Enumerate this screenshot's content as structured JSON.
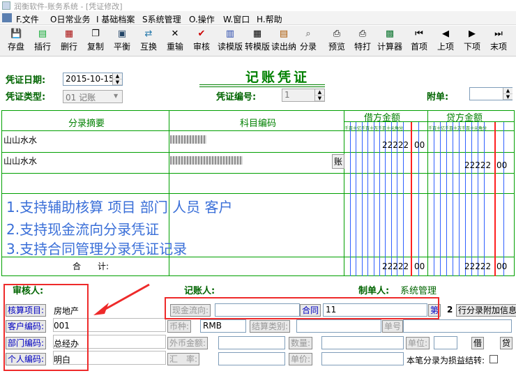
{
  "window": {
    "title": "润衡软件-账务系统 - [凭证修改]"
  },
  "menu": [
    {
      "label": "F.文件"
    },
    {
      "label": "O日常业务"
    },
    {
      "label": "I 基础档案"
    },
    {
      "label": "S系统管理"
    },
    {
      "label": "O.操作"
    },
    {
      "label": "W.窗口"
    },
    {
      "label": "H.帮助"
    }
  ],
  "toolbar": [
    {
      "label": "存盘",
      "icon": "save-icon"
    },
    {
      "label": "插行",
      "icon": "insert-row-icon"
    },
    {
      "label": "删行",
      "icon": "delete-row-icon"
    },
    {
      "label": "复制",
      "icon": "copy-icon"
    },
    {
      "label": "平衡",
      "icon": "balance-icon"
    },
    {
      "label": "互换",
      "icon": "swap-icon"
    },
    {
      "label": "重输",
      "icon": "reset-icon"
    },
    {
      "label": "审核",
      "icon": "audit-icon"
    },
    {
      "label": "读模版",
      "icon": "read-template-icon"
    },
    {
      "label": "转模版",
      "icon": "save-template-icon"
    },
    {
      "label": "读出纳",
      "icon": "read-cashier-icon"
    },
    {
      "label": "分录",
      "icon": "entry-icon"
    },
    {
      "label": "预览",
      "icon": "preview-icon"
    },
    {
      "label": "特打",
      "icon": "print-icon"
    },
    {
      "label": "计算器",
      "icon": "calculator-icon"
    },
    {
      "label": "首项",
      "icon": "first-icon"
    },
    {
      "label": "上项",
      "icon": "prev-icon"
    },
    {
      "label": "下项",
      "icon": "next-icon"
    },
    {
      "label": "末项",
      "icon": "last-icon"
    }
  ],
  "voucher": {
    "title": "记账凭证",
    "date_label": "凭证日期:",
    "date_value": "2015-10-15",
    "type_label": "凭证类型:",
    "type_value": "01 记账",
    "number_label": "凭证编号:",
    "number_value": "1",
    "attach_label": "附单:"
  },
  "grid": {
    "col_summary": "分录摘要",
    "col_account": "科目编码",
    "col_debit": "借方金额",
    "col_credit": "贷方金额",
    "digit_units": "千百十亿千百十万千百十元角分",
    "rows": [
      {
        "summary": "山山水水",
        "debit_int": "22222",
        "debit_dec": "00",
        "credit_int": "",
        "credit_dec": ""
      },
      {
        "summary": "山山水水",
        "debit_int": "",
        "debit_dec": "",
        "credit_int": "22222",
        "credit_dec": "00",
        "button": "账"
      }
    ],
    "total_label": "合　　计:",
    "total_debit_int": "22222",
    "total_debit_dec": "00",
    "total_credit_int": "22222",
    "total_credit_dec": "00"
  },
  "notes": [
    "1.支持辅助核算 项目 部门 人员 客户",
    "2.支持现金流向分录凭证",
    "3.支持合同管理分录凭证记录"
  ],
  "signatures": {
    "auditor_label": "审核人:",
    "bookkeeper_label": "记账人:",
    "maker_label": "制单人:",
    "maker_value": "系统管理"
  },
  "aux": {
    "project_label": "核算项目:",
    "project_value": "房地产",
    "customer_label": "客户编码:",
    "customer_value": "001",
    "dept_label": "部门编码:",
    "dept_value": "总经办",
    "person_label": "个人编码:",
    "person_value": "明白",
    "cashflow_label": "现金流向:",
    "contract_label": "合同",
    "contract_value": "11",
    "contract_btn": "第",
    "page_no": "2",
    "attach_btn": "行分录附加信息",
    "currency_label": "币种:",
    "currency_value": "RMB",
    "settle_label": "结算类别:",
    "bill_label": "单号",
    "foreign_label": "外币金额:",
    "qty_label": "数量:",
    "unit_label": "单位:",
    "debit_btn": "借",
    "credit_btn": "贷",
    "rate_label": "汇　率:",
    "price_label": "单价:",
    "pl_label": "本笔分录为损益结转:"
  }
}
